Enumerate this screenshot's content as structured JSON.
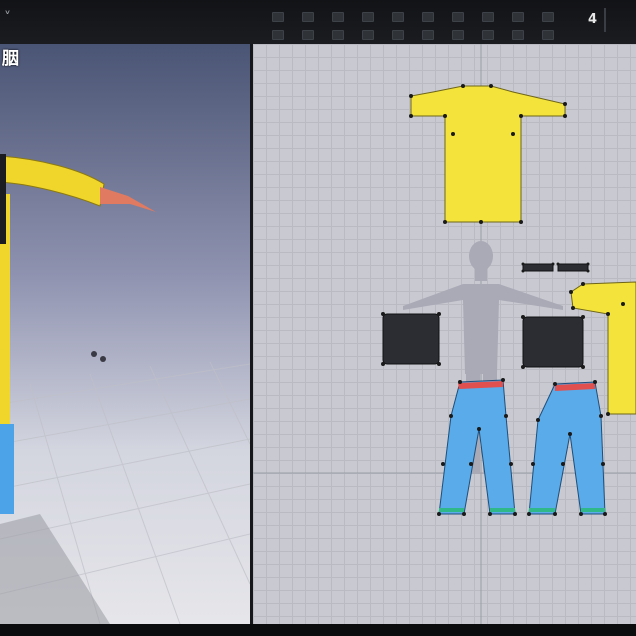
{
  "toolbar": {
    "corner_glyph": "˅",
    "icon_names": [
      "select-icon",
      "move-icon",
      "rotate-icon",
      "scale-icon",
      "pin-icon",
      "fold-icon",
      "sew-icon",
      "segment-icon",
      "trace-icon",
      "internal-line-icon",
      "point-icon",
      "curve-icon",
      "dart-icon",
      "notch-icon",
      "symmetry-icon",
      "lock-icon",
      "hide-icon",
      "texture-icon",
      "fabric-icon",
      "layer-icon"
    ],
    "number_label": "4"
  },
  "view3d": {
    "label": "胭",
    "avatar_color": "#3d5a8f",
    "shirt_color": "#f0d52a",
    "pants_color": "#4da3e8",
    "skin_color": "#e07a60"
  },
  "view2d": {
    "pattern_colors": {
      "shirt": "#f3e33a",
      "pants": "#5aabea",
      "dark": "#2b2d33",
      "waist_trim": "#e0504f",
      "hem_trim": "#2fb88a",
      "avatar_silhouette": "#a9aab6",
      "vertex": "#1a1a1a"
    },
    "pieces": [
      "shirt-front-pattern",
      "shirt-back-pattern",
      "waistband-left-pattern",
      "waistband-right-pattern",
      "pocket-left-pattern",
      "pocket-right-pattern",
      "pants-left-pattern",
      "pants-right-pattern"
    ]
  }
}
